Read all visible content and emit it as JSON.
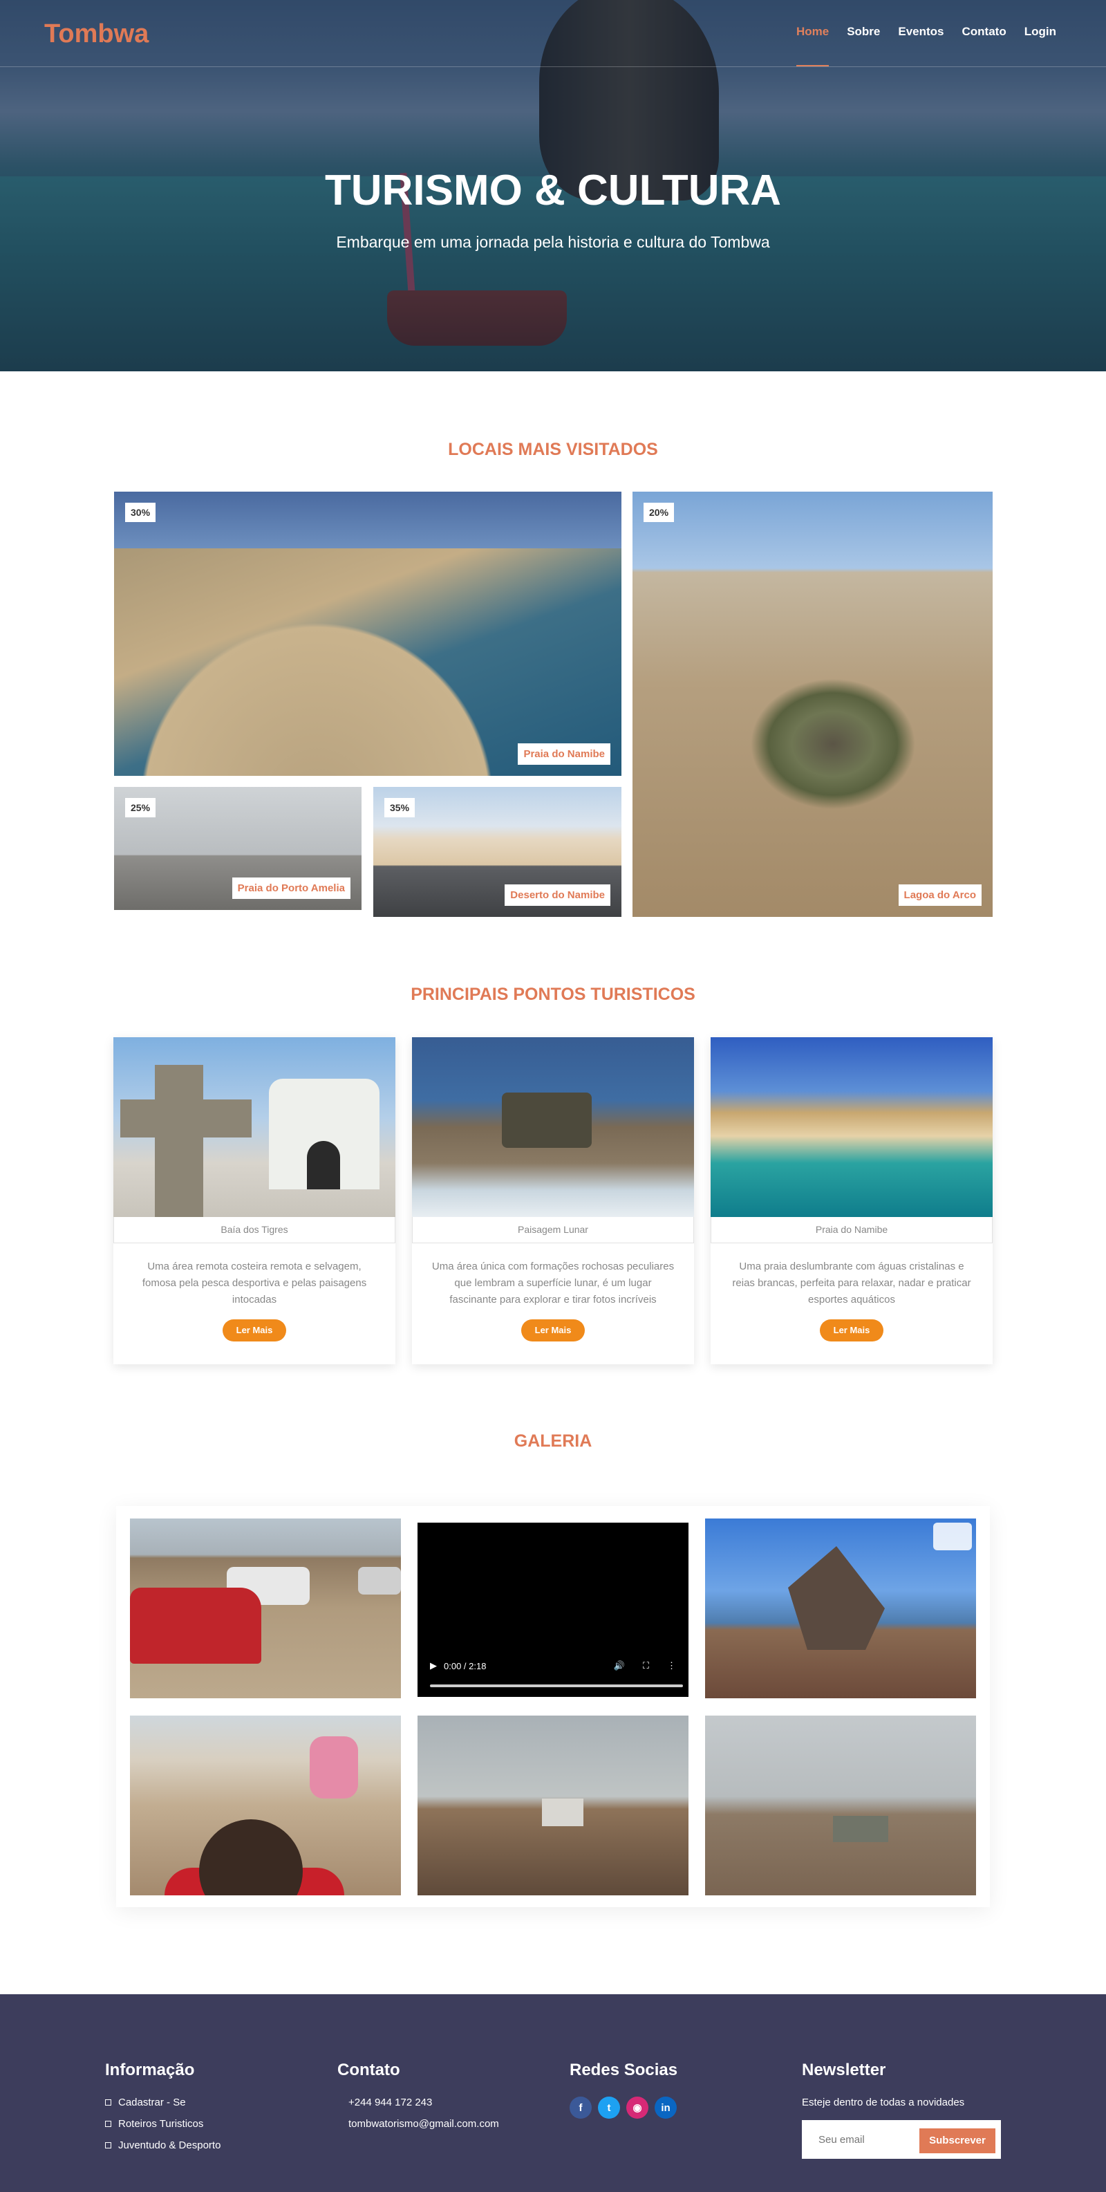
{
  "header": {
    "logo": "Tombwa",
    "nav": [
      "Home",
      "Sobre",
      "Eventos",
      "Contato",
      "Login"
    ]
  },
  "hero": {
    "title": "TURISMO & CULTURA",
    "subtitle": "Embarque em uma jornada pela historia e cultura do Tombwa"
  },
  "locais": {
    "title": "LOCAIS MAIS VISITADOS",
    "tiles": [
      {
        "percent": "30%",
        "label": "Praia do Namibe"
      },
      {
        "percent": "20%",
        "label": "Lagoa do Arco"
      },
      {
        "percent": "25%",
        "label": "Praia do Porto Amelia"
      },
      {
        "percent": "35%",
        "label": "Deserto do Namibe"
      }
    ]
  },
  "pontos": {
    "title": "PRINCIPAIS PONTOS TURISTICOS",
    "cards": [
      {
        "caption": "Baía dos Tigres",
        "description": "Uma área remota costeira remota e selvagem, fomosa pela pesca desportiva e pelas paisagens intocadas",
        "button": "Ler Mais"
      },
      {
        "caption": "Paisagem Lunar",
        "description": "Uma área única com formações rochosas peculiares que lembram a superfície lunar, é um lugar fascinante para explorar e tirar fotos incríveis",
        "button": "Ler Mais"
      },
      {
        "caption": "Praia do Namibe",
        "description": "Uma praia deslumbrante com águas cristalinas e reias brancas, perfeita para relaxar, nadar e praticar esportes aquáticos",
        "button": "Ler Mais"
      }
    ]
  },
  "galeria": {
    "title": "GALERIA",
    "video_time": "0:00 / 2:18"
  },
  "footer": {
    "info": {
      "title": "Informação",
      "items": [
        "Cadastrar - Se",
        "Roteiros Turisticos",
        "Juventudo & Desporto"
      ]
    },
    "contato": {
      "title": "Contato",
      "phone": "+244 944 172 243",
      "email": "tombwatorismo@gmail.com.com"
    },
    "redes": {
      "title": "Redes Socias"
    },
    "newsletter": {
      "title": "Newsletter",
      "text": "Esteje dentro de todas a novidades",
      "placeholder": "Seu email",
      "button": "Subscrever"
    }
  },
  "colors": {
    "accent": "#e07a56",
    "button_orange": "#f08a1a",
    "footer_bg": "#3d3d5c"
  },
  "icons": [
    "facebook-icon",
    "twitter-icon",
    "instagram-icon",
    "linkedin-icon",
    "play-icon",
    "volume-icon",
    "fullscreen-icon",
    "more-options-icon"
  ]
}
